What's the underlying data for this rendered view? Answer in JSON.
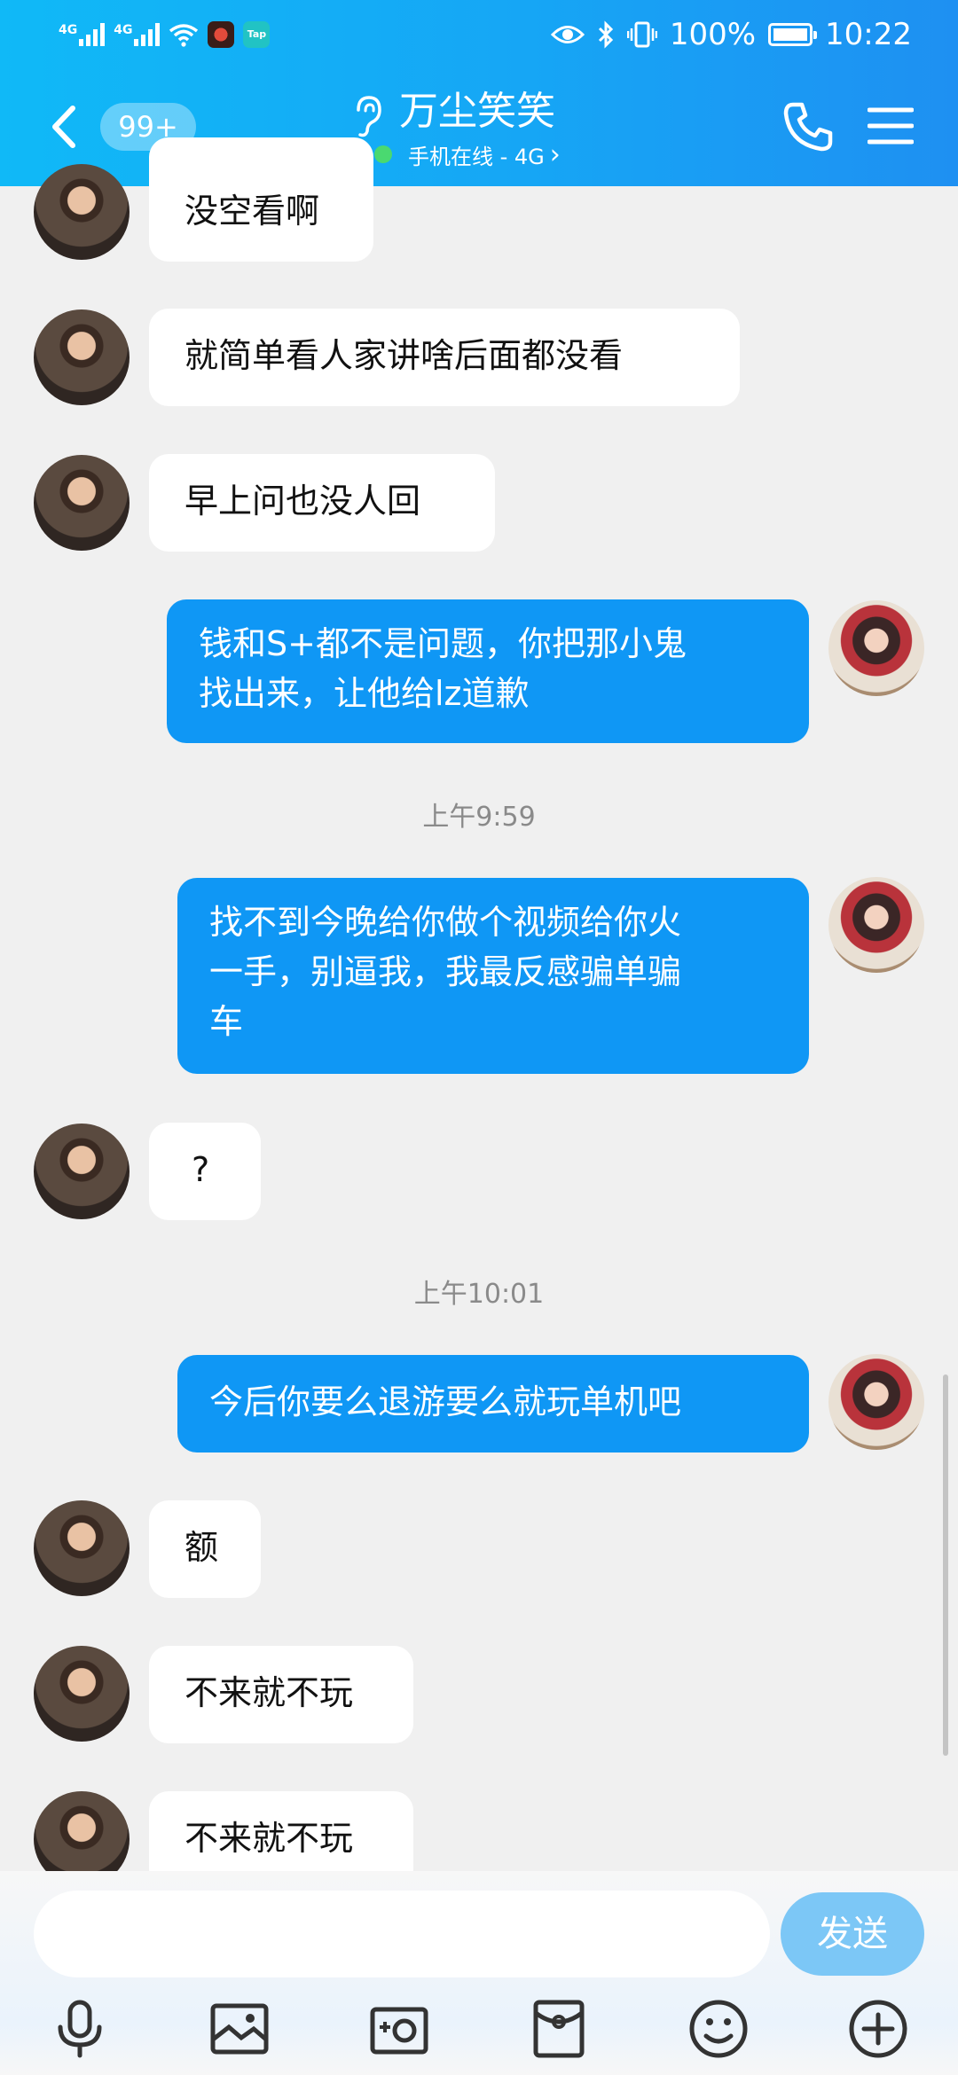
{
  "status_bar": {
    "signal1_label": "4G",
    "signal2_label": "4G",
    "app_icon_label": "Tap",
    "battery": "100%",
    "time": "10:22"
  },
  "header": {
    "unread_count": "99+",
    "contact_name": "万尘笑笑",
    "contact_status": "手机在线 - 4G",
    "status_chevron": "›"
  },
  "messages": [
    {
      "type": "in",
      "text": "没空看啊"
    },
    {
      "type": "in",
      "text": "就简单看人家讲啥后面都没看"
    },
    {
      "type": "in",
      "text": "早上问也没人回"
    },
    {
      "type": "out",
      "text": "钱和S+都不是问题，你把那小鬼\n找出来，让他给lz道歉"
    },
    {
      "type": "time",
      "text": "上午9:59"
    },
    {
      "type": "out",
      "text": "找不到今晚给你做个视频给你火\n一手，别逼我，我最反感骗单骗\n车"
    },
    {
      "type": "in",
      "text": "?"
    },
    {
      "type": "time",
      "text": "上午10:01"
    },
    {
      "type": "out",
      "text": "今后你要么退游要么就玩单机吧"
    },
    {
      "type": "in",
      "text": "额"
    },
    {
      "type": "in",
      "text": "不来就不玩"
    },
    {
      "type": "in",
      "text": "不来就不玩"
    }
  ],
  "input": {
    "value": "",
    "send_label": "发送"
  },
  "toolbar": {
    "icons": [
      "microphone-icon",
      "image-icon",
      "camera-icon",
      "red-packet-icon",
      "emoji-icon",
      "plus-icon"
    ]
  },
  "colors": {
    "header_start": "#10b9f7",
    "header_end": "#1e90f2",
    "outgoing_bubble": "#0f97f5",
    "incoming_bubble": "#ffffff",
    "send_button": "#7cc7f6",
    "online_dot": "#4ad970"
  }
}
